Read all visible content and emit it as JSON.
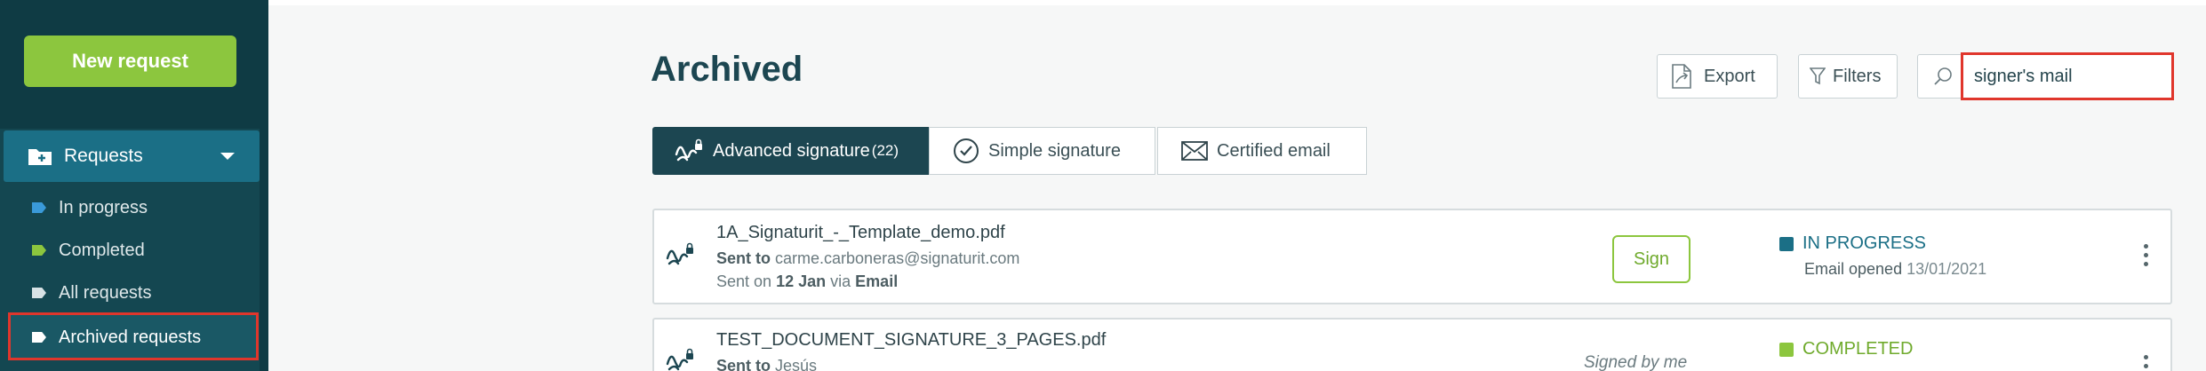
{
  "sidebar": {
    "new_request_label": "New request",
    "requests_label": "Requests",
    "items": [
      {
        "label": "In progress",
        "color": "#3a9ad9"
      },
      {
        "label": "Completed",
        "color": "#8cc63e"
      },
      {
        "label": "All requests",
        "color": "#d8e2e5"
      },
      {
        "label": "Archived requests",
        "color": "#ffffff"
      }
    ]
  },
  "main": {
    "title": "Archived",
    "export_label": "Export",
    "filters_label": "Filters",
    "search": {
      "value": "signer's mail"
    }
  },
  "tabs": [
    {
      "label": "Advanced signature",
      "count": "(22)"
    },
    {
      "label": "Simple signature"
    },
    {
      "label": "Certified email"
    }
  ],
  "rows": [
    {
      "name": "1A_Signaturit_-_Template_demo.pdf",
      "sent_to_label": "Sent to",
      "sent_to": "carme.carboneras@signaturit.com",
      "sent_on_prefix": "Sent on",
      "sent_on_date": "12 Jan",
      "via": "via",
      "channel": "Email",
      "action": "Sign",
      "status": "IN PROGRESS",
      "status_color": "#1b6f86",
      "status_detail": "Email opened",
      "status_date": "13/01/2021"
    },
    {
      "name": "TEST_DOCUMENT_SIGNATURE_3_PAGES.pdf",
      "sent_to_label": "Sent to",
      "sent_to": "Jesús",
      "action_note": "Signed by me",
      "status": "COMPLETED",
      "status_color": "#8cc63e"
    }
  ]
}
